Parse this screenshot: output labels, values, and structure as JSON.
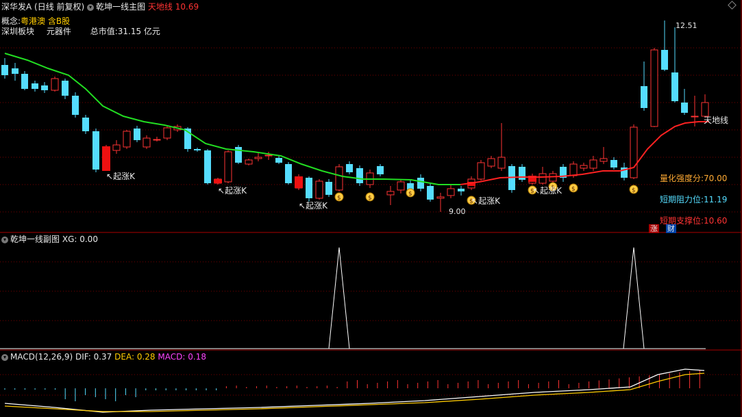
{
  "main": {
    "stock_name": "深华发A",
    "period": "(日线 前复权)",
    "indicator_name": "乾坤一线主图",
    "indicator_label": "天地线",
    "indicator_value": "10.69",
    "concept_label": "概念:",
    "concept_value": "粤港澳 含B股",
    "board_label": "深圳板块",
    "industry": "元器件",
    "market_cap_label": "总市值:",
    "market_cap_value": "31.15 亿元",
    "high_label": "12.51",
    "low_label": "9.00",
    "line_label": "天地线",
    "signal_label": "起涨K",
    "stats": [
      {
        "label": "量化强度分:",
        "value": "70.00",
        "color": "#ffaa33"
      },
      {
        "label": "短期阻力位:",
        "value": "11.19",
        "color": "#55ddff"
      },
      {
        "label": "短期支撑位:",
        "value": "10.60",
        "color": "#ff3333"
      }
    ],
    "badges": [
      {
        "label": "涨",
        "bg": "#aa0000"
      },
      {
        "label": "财",
        "bg": "#0044aa"
      }
    ]
  },
  "sub": {
    "indicator_name": "乾坤一线副图",
    "xg_label": "XG:",
    "xg_value": "0.00"
  },
  "macd": {
    "name": "MACD(12,26,9)",
    "dif_label": "DIF:",
    "dif_value": "0.37",
    "dea_label": "DEA:",
    "dea_value": "0.28",
    "macd_label": "MACD:",
    "macd_value": "0.18"
  },
  "colors": {
    "up": "#ff3333",
    "down": "#55ddff",
    "line_green": "#22dd22",
    "line_red": "#ff2222",
    "grid": "#7a0000"
  },
  "icons": [
    "money-bag-icon",
    "arrow-icon",
    "collapse-icon",
    "expand-icon"
  ]
}
